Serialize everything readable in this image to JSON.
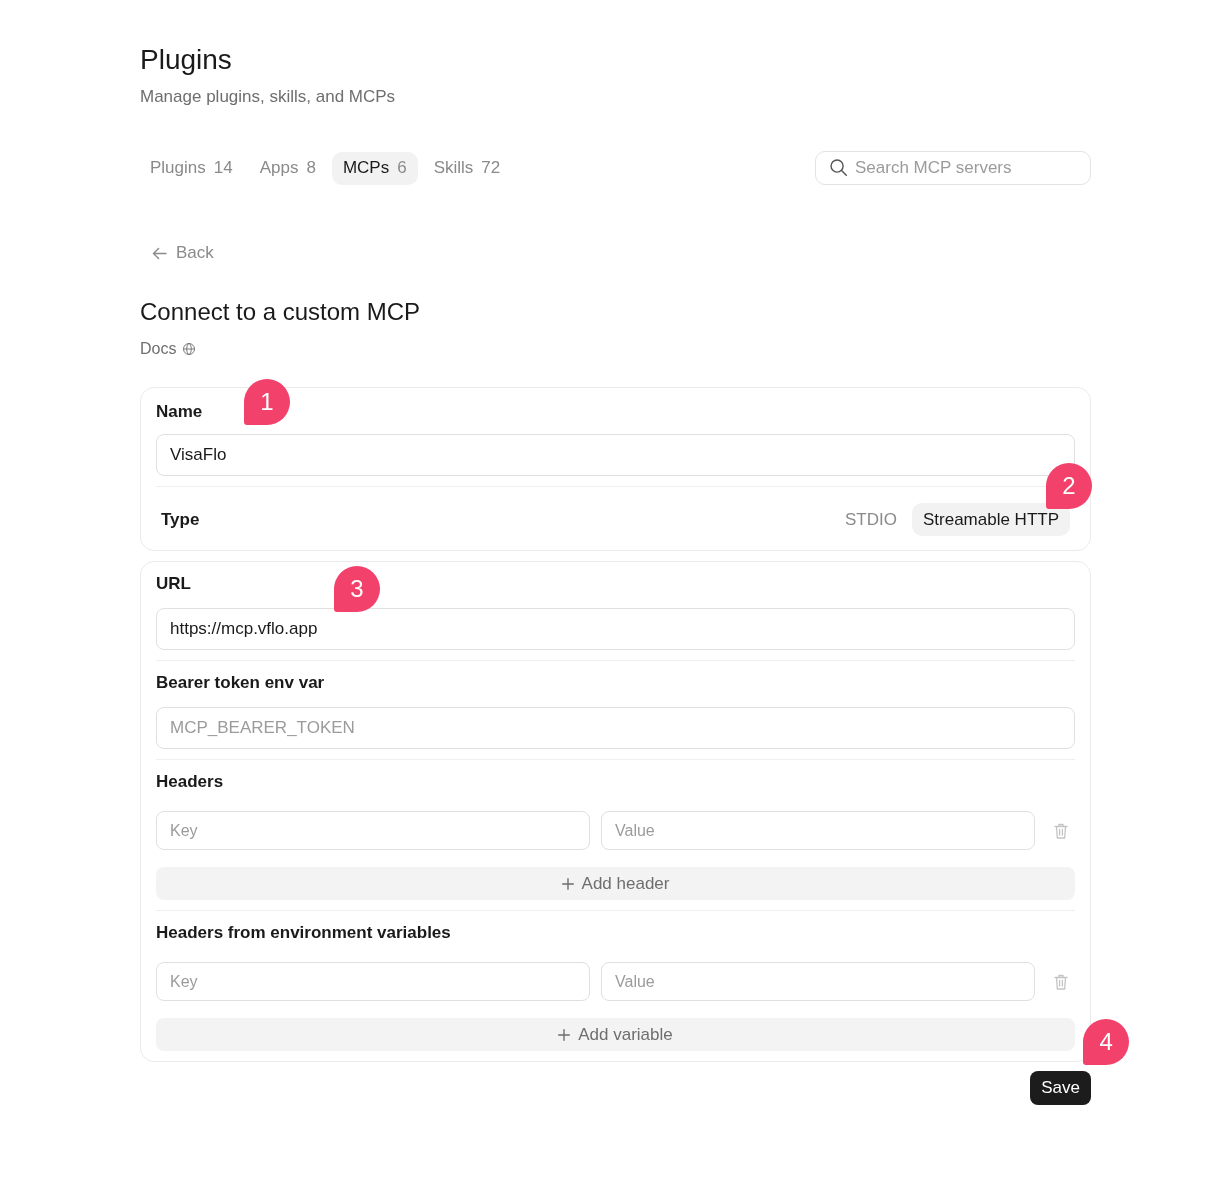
{
  "header": {
    "title": "Plugins",
    "subtitle": "Manage plugins, skills, and MCPs"
  },
  "tabs": [
    {
      "label": "Plugins",
      "count": "14",
      "selected": false
    },
    {
      "label": "Apps",
      "count": "8",
      "selected": false
    },
    {
      "label": "MCPs",
      "count": "6",
      "selected": true
    },
    {
      "label": "Skills",
      "count": "72",
      "selected": false
    }
  ],
  "search": {
    "placeholder": "Search MCP servers"
  },
  "back": {
    "label": "Back"
  },
  "form": {
    "title": "Connect to a custom MCP",
    "docs_link": "Docs",
    "name_field": {
      "label": "Name",
      "value": "VisaFlo",
      "callout": "1"
    },
    "type": {
      "label": "Type",
      "options": [
        {
          "label": "STDIO",
          "selected": false
        },
        {
          "label": "Streamable HTTP",
          "selected": true
        }
      ],
      "callout": "2"
    },
    "url_field": {
      "label": "URL",
      "value": "https://mcp.vflo.app",
      "callout": "3"
    },
    "bearer_field": {
      "label": "Bearer token env var",
      "placeholder": "MCP_BEARER_TOKEN"
    },
    "header_sections": [
      {
        "title": "Headers",
        "rows": [
          {
            "key_placeholder": "Key",
            "value_placeholder": "Value"
          }
        ],
        "add_button": "Add header"
      },
      {
        "title": "Headers from environment variables",
        "rows": [
          {
            "key_placeholder": "Key",
            "value_placeholder": "Value"
          }
        ],
        "add_button": "Add variable"
      }
    ]
  },
  "save_button": {
    "label": "Save",
    "callout": "4"
  }
}
